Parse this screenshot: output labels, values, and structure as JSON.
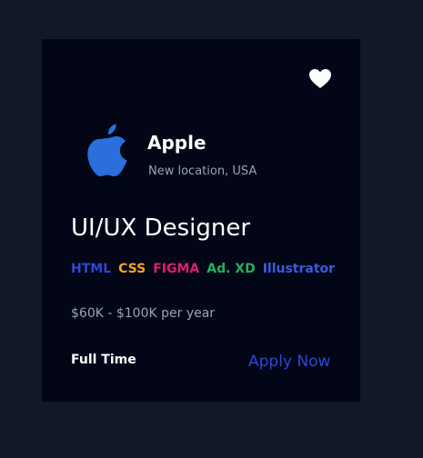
{
  "card": {
    "favorite_icon": "heart-icon",
    "company": {
      "logo_icon": "apple-logo-icon",
      "name": "Apple",
      "location": "New location, USA"
    },
    "job_title": "UI/UX Designer",
    "tags": [
      {
        "label": "HTML",
        "color": "#2f46d6"
      },
      {
        "label": "CSS",
        "color": "#f5a524"
      },
      {
        "label": "FIGMA",
        "color": "#e11d6a"
      },
      {
        "label": "Ad. XD",
        "color": "#22b15e"
      },
      {
        "label": "Illustrator",
        "color": "#3b5bdb"
      }
    ],
    "salary": "$60K - $100K per year",
    "job_type": "Full Time",
    "apply_label": "Apply Now"
  },
  "colors": {
    "page_background": "#121827",
    "card_background": "#020617",
    "accent": "#2f46d6",
    "logo_blue": "#2a6fdb",
    "muted_text": "#9aa3b2"
  }
}
